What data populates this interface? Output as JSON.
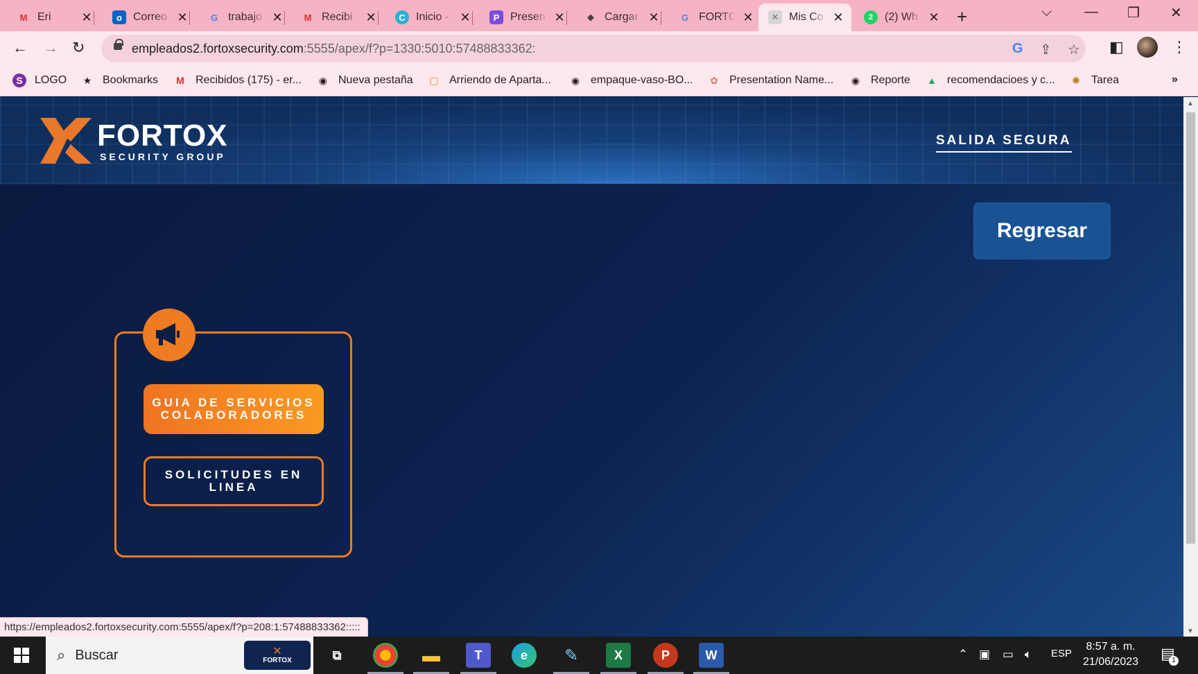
{
  "browser": {
    "tabs": [
      {
        "title": "Eri",
        "icon": "gmail-chat-icon"
      },
      {
        "title": "Correo",
        "icon": "outlook-icon"
      },
      {
        "title": "trabajo",
        "icon": "google-icon"
      },
      {
        "title": "Recibi",
        "icon": "gmail-icon"
      },
      {
        "title": "Inicio -",
        "icon": "canva-icon"
      },
      {
        "title": "Presen",
        "icon": "presentation-icon"
      },
      {
        "title": "Cargar",
        "icon": "graduation-cap-icon"
      },
      {
        "title": "FORTO",
        "icon": "google-icon"
      },
      {
        "title": "Mis Co",
        "icon": "fortox-icon",
        "active": true
      },
      {
        "title": "(2) Wh",
        "icon": "whatsapp-icon"
      }
    ],
    "url_host": "empleados2.fortoxsecurity.com",
    "url_rest": ":5555/apex/f?p=1330:5010:57488833362:",
    "bookmarks": [
      {
        "label": "LOGO",
        "icon": "skrill-icon"
      },
      {
        "label": "Bookmarks",
        "icon": "star-icon"
      },
      {
        "label": "Recibidos (175) - er...",
        "icon": "gmail-icon"
      },
      {
        "label": "Nueva pestaña",
        "icon": "globe-icon"
      },
      {
        "label": "Arriendo de Aparta...",
        "icon": "frame-icon"
      },
      {
        "label": "empaque-vaso-BO...",
        "icon": "globe-icon"
      },
      {
        "label": "Presentation Name...",
        "icon": "flower-icon"
      },
      {
        "label": "Reporte",
        "icon": "globe-icon"
      },
      {
        "label": "recomendacioes y c...",
        "icon": "google-drive-icon"
      },
      {
        "label": "Tarea",
        "icon": "seal-icon"
      }
    ],
    "status_url": "https://empleados2.fortoxsecurity.com:5555/apex/f?p=208:1:57488833362:::::"
  },
  "page": {
    "logo_name": "FORTOX",
    "logo_sub": "SECURITY GROUP",
    "salida": "SALIDA SEGURA",
    "regresar": "Regresar",
    "guia": "GUIA DE SERVICIOS COLABORADORES",
    "solicitudes": "SOLICITUDES EN LINEA",
    "accent": "#f07c22",
    "button_blue": "#1a5294"
  },
  "taskbar": {
    "search": "Buscar",
    "search_badge": "FORTOX",
    "language": "ESP",
    "time": "8:57 a. m.",
    "date": "21/06/2023",
    "notifications": "1"
  }
}
